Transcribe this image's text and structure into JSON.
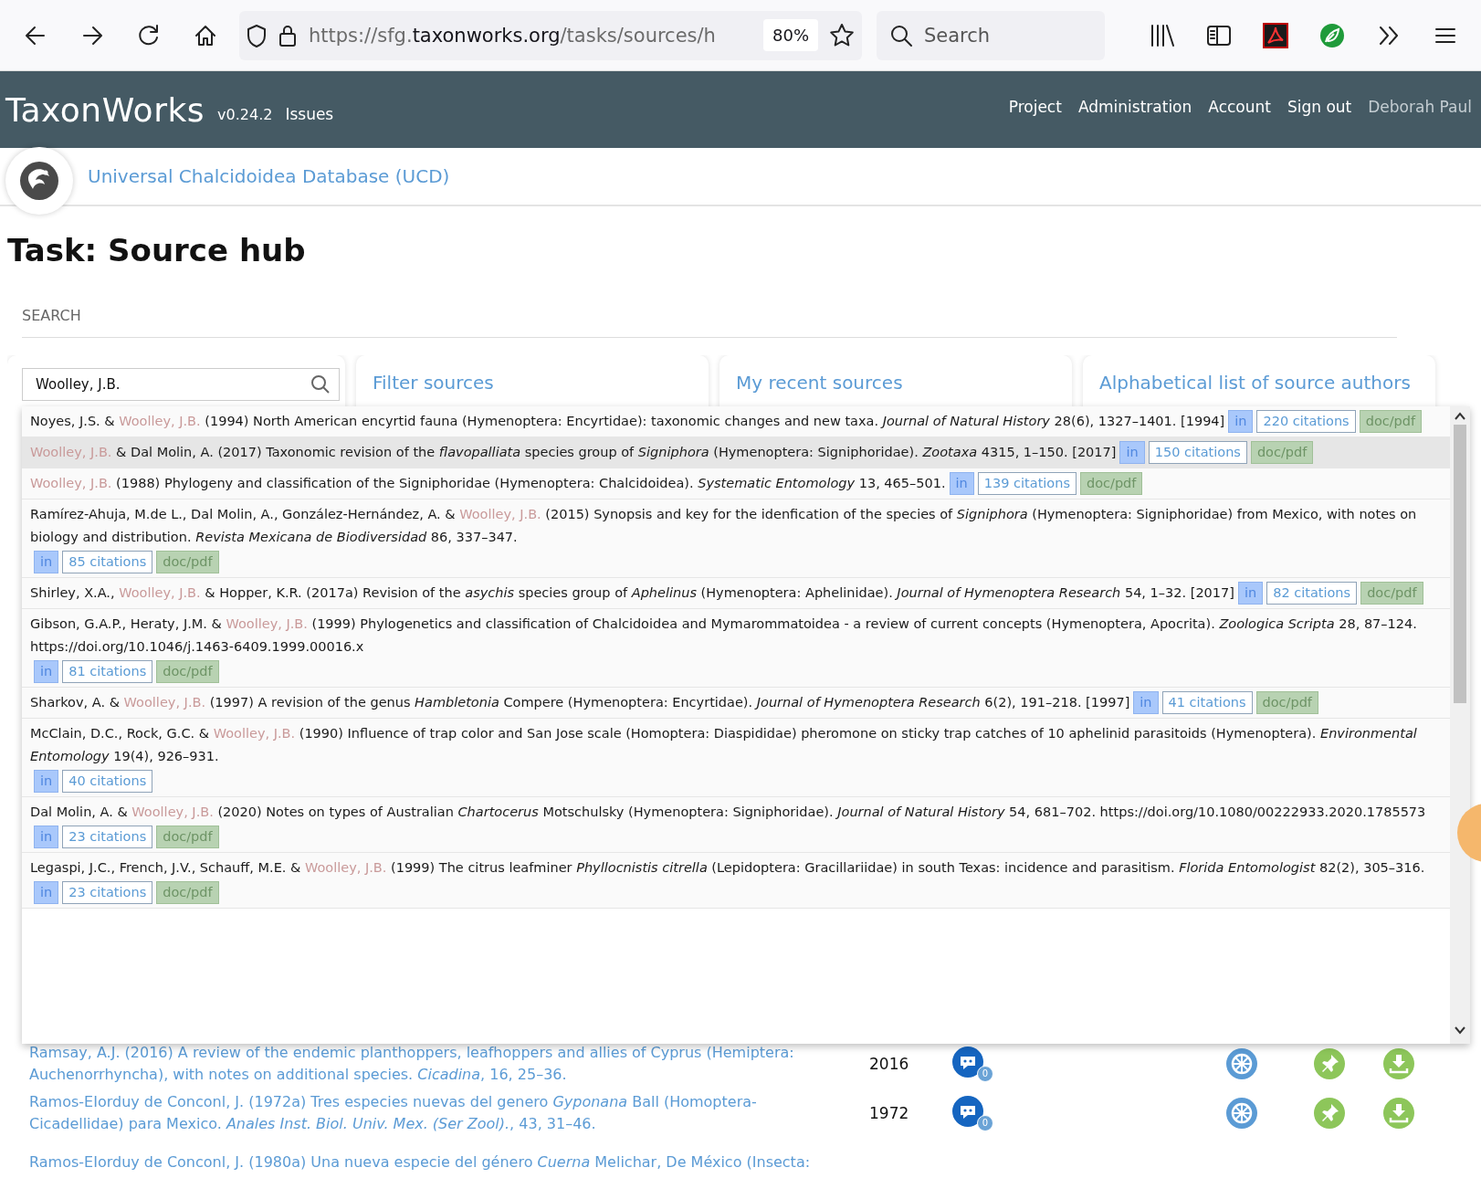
{
  "browser": {
    "url_prefix": "https://sfg.",
    "url_domain": "taxonworks.org",
    "url_path": "/tasks/sources/h",
    "zoom": "80%",
    "search_placeholder": "Search"
  },
  "navbar": {
    "brand": "TaxonWorks",
    "version": "v0.24.2",
    "issues": "Issues",
    "links": [
      "Project",
      "Administration",
      "Account",
      "Sign out"
    ],
    "user": "Deborah Paul"
  },
  "project": {
    "name": "Universal Chalcidoidea Database (UCD)"
  },
  "page_title": "Task: Source hub",
  "section_label": "SEARCH",
  "search": {
    "value": "Woolley, J.B."
  },
  "panels": [
    "Filter sources",
    "My recent sources",
    "Alphabetical list of source authors"
  ],
  "results": [
    {
      "selected": false,
      "segments": [
        {
          "kind": "plain",
          "text": "Noyes, J.S. & "
        },
        {
          "kind": "match",
          "text": "Woolley, J.B."
        },
        {
          "kind": "plain",
          "text": " (1994) North American encyrtid fauna (Hymenoptera: Encyrtidae): taxonomic changes and new taxa. *Journal of Natural History* 28(6), 1327–1401. [1994]"
        }
      ],
      "in": "in",
      "citations": "220 citations",
      "document": "doc/pdf"
    },
    {
      "selected": true,
      "segments": [
        {
          "kind": "match",
          "text": "Woolley, J.B."
        },
        {
          "kind": "plain",
          "text": " & Dal Molin, A. (2017) Taxonomic revision of the *flavopalliata* species group of *Signiphora* (Hymenoptera: Signiphoridae). *Zootaxa* 4315, 1–150. [2017]"
        }
      ],
      "in": "in",
      "citations": "150 citations",
      "document": "doc/pdf"
    },
    {
      "selected": false,
      "segments": [
        {
          "kind": "match",
          "text": "Woolley, J.B."
        },
        {
          "kind": "plain",
          "text": " (1988) Phylogeny and classification of the Signiphoridae (Hymenoptera: Chalcidoidea). *Systematic Entomology* 13, 465–501."
        }
      ],
      "in": "in",
      "citations": "139 citations",
      "document": "doc/pdf"
    },
    {
      "selected": false,
      "segments": [
        {
          "kind": "plain",
          "text": "Ramírez-Ahuja, M.de L., Dal Molin, A., González-Hernández, A. & "
        },
        {
          "kind": "match",
          "text": "Woolley, J.B."
        },
        {
          "kind": "plain",
          "text": " (2015) Synopsis and key for the idenfication of the species of *Signiphora* (Hymenoptera: Signiphoridae) from Mexico, with notes on biology and distribution. *Revista Mexicana de Biodiversidad* 86, 337–347."
        }
      ],
      "in": "in",
      "citations": "85 citations",
      "document": "doc/pdf"
    },
    {
      "selected": false,
      "segments": [
        {
          "kind": "plain",
          "text": "Shirley, X.A., "
        },
        {
          "kind": "match",
          "text": "Woolley, J.B."
        },
        {
          "kind": "plain",
          "text": " & Hopper, K.R. (2017a) Revision of the *asychis* species group of *Aphelinus* (Hymenoptera: Aphelinidae). *Journal of Hymenoptera Research* 54, 1–32. [2017]"
        }
      ],
      "in": "in",
      "citations": "82 citations",
      "document": "doc/pdf"
    },
    {
      "selected": false,
      "segments": [
        {
          "kind": "plain",
          "text": "Gibson, G.A.P., Heraty, J.M. & "
        },
        {
          "kind": "match",
          "text": "Woolley, J.B."
        },
        {
          "kind": "plain",
          "text": " (1999) Phylogenetics and classification of Chalcidoidea and Mymarommatoidea - a review of current concepts (Hymenoptera, Apocrita). *Zoologica Scripta* 28, 87–124. https://doi.org/10.1046/j.1463-6409.1999.00016.x"
        }
      ],
      "in": "in",
      "citations": "81 citations",
      "document": "doc/pdf"
    },
    {
      "selected": false,
      "segments": [
        {
          "kind": "plain",
          "text": "Sharkov, A. & "
        },
        {
          "kind": "match",
          "text": "Woolley, J.B."
        },
        {
          "kind": "plain",
          "text": " (1997) A revision of the genus *Hambletonia* Compere (Hymenoptera: Encyrtidae). *Journal of Hymenoptera Research* 6(2), 191–218. [1997]"
        }
      ],
      "in": "in",
      "citations": "41 citations",
      "document": "doc/pdf"
    },
    {
      "selected": false,
      "segments": [
        {
          "kind": "plain",
          "text": "McClain, D.C., Rock, G.C. & "
        },
        {
          "kind": "match",
          "text": "Woolley, J.B."
        },
        {
          "kind": "plain",
          "text": " (1990) Influence of trap color and San Jose scale (Homoptera: Diaspididae) pheromone on sticky trap catches of 10 aphelinid parasitoids (Hymenoptera). *Environmental Entomology* 19(4), 926–931."
        }
      ],
      "in": "in",
      "citations": "40 citations"
    },
    {
      "selected": false,
      "segments": [
        {
          "kind": "plain",
          "text": "Dal Molin, A. & "
        },
        {
          "kind": "match",
          "text": "Woolley, J.B."
        },
        {
          "kind": "plain",
          "text": " (2020) Notes on types of Australian *Chartocerus* Motschulsky (Hymenoptera: Signiphoridae). *Journal of Natural History* 54, 681–702. https://doi.org/10.1080/00222933.2020.1785573"
        }
      ],
      "in": "in",
      "citations": "23 citations",
      "document": "doc/pdf"
    },
    {
      "selected": false,
      "segments": [
        {
          "kind": "plain",
          "text": "Legaspi, J.C., French, J.V., Schauff, M.E. & "
        },
        {
          "kind": "match",
          "text": "Woolley, J.B."
        },
        {
          "kind": "plain",
          "text": " (1999) The citrus leafminer *Phyllocnistis citrella* (Lepidoptera: Gracillariidae) in south Texas: incidence and parasitism. *Florida Entomologist* 82(2), 305–316."
        }
      ],
      "in": "in",
      "citations": "23 citations",
      "document": "doc/pdf"
    }
  ],
  "sources": [
    {
      "citation": "Ramsay, A.J. (2016) A review of the endemic planthoppers, leafhoppers and allies of Cyprus (Hemiptera: Auchenorrhyncha), with notes on additional species. *Cicadina*, 16, 25–36.",
      "year": "2016",
      "comments": "0"
    },
    {
      "citation": "Ramos-EIorduy de Conconl, J. (1972a) Tres especies nuevas del genero *Gyponana* Ball (Homoptera-Cicadellidae) para Mexico. *Anales Inst. Biol. Univ. Mex. (Ser Zool).*, 43, 31–46.",
      "year": "1972",
      "comments": "0"
    },
    {
      "citation": "Ramos-EIorduy de Conconl, J. (1980a) Una nueva especie del género *Cuerna* Melichar, De México (Insecta:"
    }
  ]
}
